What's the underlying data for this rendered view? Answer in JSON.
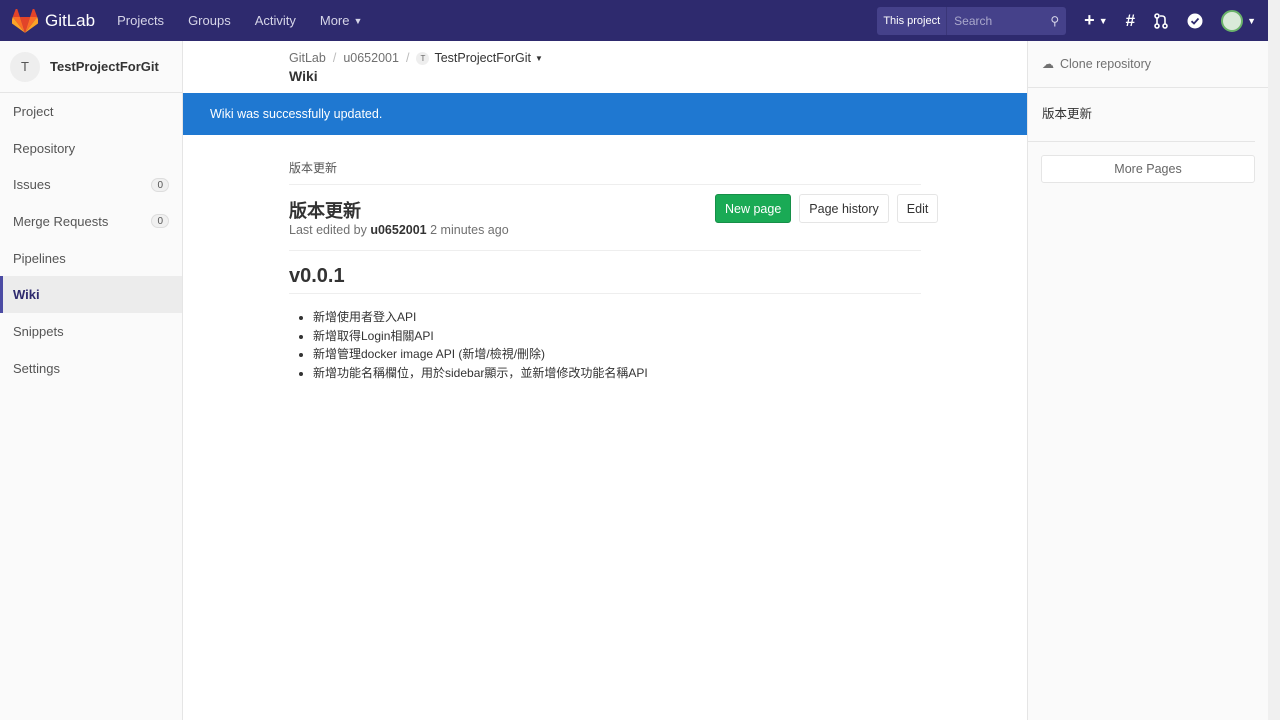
{
  "topnav": {
    "brand": "GitLab",
    "links": [
      "Projects",
      "Groups",
      "Activity",
      "More"
    ],
    "search_scope": "This project",
    "search_placeholder": "Search"
  },
  "sidebar": {
    "project_initial": "T",
    "project_name": "TestProjectForGit",
    "items": [
      {
        "label": "Project"
      },
      {
        "label": "Repository"
      },
      {
        "label": "Issues",
        "badge": "0"
      },
      {
        "label": "Merge Requests",
        "badge": "0"
      },
      {
        "label": "Pipelines"
      },
      {
        "label": "Wiki",
        "active": true
      },
      {
        "label": "Snippets"
      },
      {
        "label": "Settings"
      }
    ]
  },
  "breadcrumb": {
    "root": "GitLab",
    "user": "u0652001",
    "project_initial": "T",
    "project": "TestProjectForGit",
    "title": "Wiki"
  },
  "flash": "Wiki was successfully updated.",
  "wiki": {
    "path": "版本更新",
    "title": "版本更新",
    "last_edited_prefix": "Last edited by",
    "author": "u0652001",
    "time_ago": "2 minutes ago",
    "buttons": {
      "new_page": "New page",
      "history": "Page history",
      "edit": "Edit"
    },
    "heading": "v0.0.1",
    "items": [
      "新增使用者登入API",
      "新增取得Login相關API",
      "新增管理docker image API (新增/檢視/刪除)",
      "新增功能名稱欄位，用於sidebar顯示，並新增修改功能名稱API"
    ]
  },
  "right_sidebar": {
    "clone": "Clone repository",
    "pages": [
      "版本更新"
    ],
    "more_pages": "More Pages"
  },
  "colors": {
    "nav": "#2e2a6e",
    "flash": "#1f78d1",
    "primary_button": "#1aaa55"
  }
}
